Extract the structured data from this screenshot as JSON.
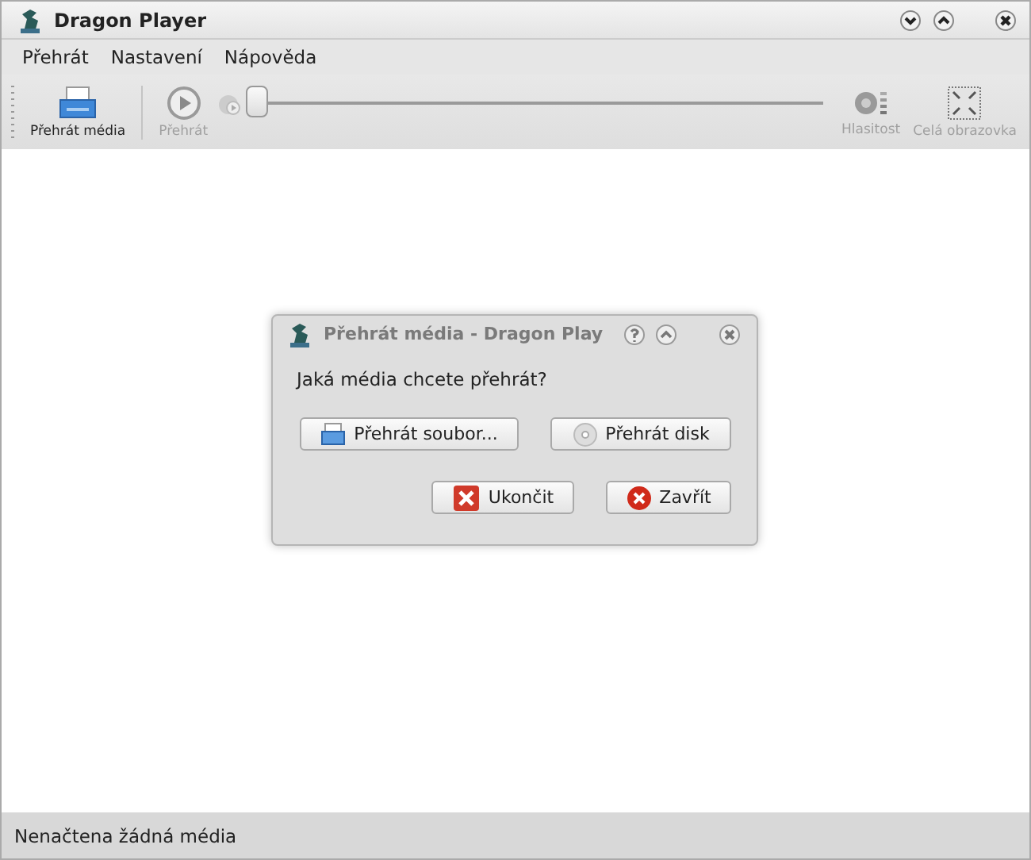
{
  "window": {
    "title": "Dragon Player"
  },
  "menu": [
    {
      "label": "Přehrát"
    },
    {
      "label": "Nastavení"
    },
    {
      "label": "Nápověda"
    }
  ],
  "toolbar": [
    {
      "kind": "button",
      "label": "Přehrát média",
      "disabled": false
    },
    {
      "kind": "button",
      "label": "Přehrát",
      "disabled": true
    },
    {
      "kind": "slider",
      "level": 0
    },
    {
      "kind": "button",
      "label": "Hlasitost",
      "disabled": true
    },
    {
      "kind": "button",
      "label": "Celá obrazovka",
      "disabled": true
    }
  ],
  "dialog": {
    "title": "Přehrát média - Dragon Play",
    "question": "Jaká média chcete přehrát?",
    "choices": [
      {
        "label": "Přehrát soubor..."
      },
      {
        "label": "Přehrát disk"
      }
    ],
    "buttons": [
      {
        "label": "Ukončit"
      },
      {
        "label": "Zavřít"
      }
    ]
  },
  "status_bar": "Nenačtena žádná média"
}
